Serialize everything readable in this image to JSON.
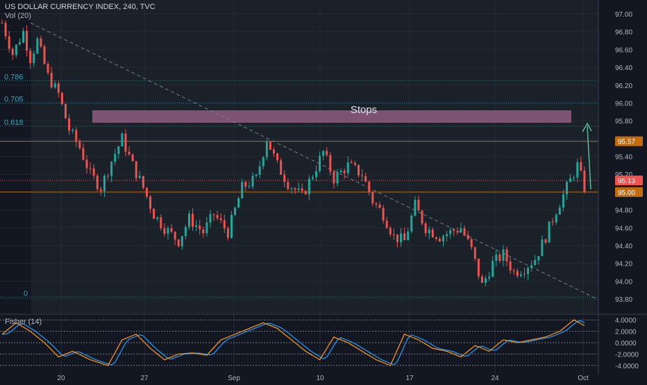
{
  "header": {
    "title": "US DOLLAR CURRENCY INDEX, 240, TVC",
    "volume_label": "Vol (20)"
  },
  "fisher": {
    "label": "Fisher (14)",
    "ticks": [
      "4.0000",
      "2.0000",
      "0.0000",
      "-2.0000",
      "-4.0000"
    ]
  },
  "annotations": {
    "stops_label": "Stops",
    "fib_levels": [
      {
        "label": "0.786",
        "price": 96.25
      },
      {
        "label": "0.705",
        "price": 96.0
      },
      {
        "label": "0.618",
        "price": 95.74
      },
      {
        "label": "0",
        "price": 93.82
      }
    ]
  },
  "price_tags": [
    {
      "label": "95.57",
      "price": 95.57,
      "color": "#c46c0d"
    },
    {
      "label": "95.13",
      "price": 95.13,
      "color": "#ef5350"
    },
    {
      "label": "95.00",
      "price": 95.0,
      "color": "#c46c0d"
    }
  ],
  "colors": {
    "background": "#131722",
    "up": "#26a69a",
    "down": "#ef5350",
    "stops_box": "#8e5c80",
    "fisher_main": "#f7931a",
    "fisher_trigger": "#2196f3"
  },
  "chart_data": {
    "type": "candlestick",
    "x_ticks": [
      "20",
      "27",
      "Sep",
      "10",
      "17",
      "24",
      "Oct"
    ],
    "y_ticks": [
      "97.00",
      "96.80",
      "96.60",
      "96.40",
      "96.20",
      "96.00",
      "95.80",
      "95.60",
      "95.40",
      "95.20",
      "95.00",
      "94.80",
      "94.60",
      "94.40",
      "94.20",
      "94.00",
      "93.80"
    ],
    "ylim": [
      93.75,
      97.05
    ],
    "series": [
      {
        "name": "Price (approximate closes)",
        "points": [
          [
            0,
            96.9
          ],
          [
            3,
            96.55
          ],
          [
            6,
            96.8
          ],
          [
            8,
            96.5
          ],
          [
            10,
            96.7
          ],
          [
            13,
            96.3
          ],
          [
            16,
            96.1
          ],
          [
            19,
            95.7
          ],
          [
            22,
            95.5
          ],
          [
            25,
            95.2
          ],
          [
            28,
            95.05
          ],
          [
            31,
            95.35
          ],
          [
            34,
            95.6
          ],
          [
            37,
            95.3
          ],
          [
            40,
            95.05
          ],
          [
            43,
            94.75
          ],
          [
            46,
            94.6
          ],
          [
            50,
            94.45
          ],
          [
            53,
            94.7
          ],
          [
            57,
            94.55
          ],
          [
            60,
            94.75
          ],
          [
            64,
            94.55
          ],
          [
            68,
            95.05
          ],
          [
            72,
            95.15
          ],
          [
            75,
            95.6
          ],
          [
            78,
            95.3
          ],
          [
            81,
            95.1
          ],
          [
            85,
            94.95
          ],
          [
            88,
            95.2
          ],
          [
            91,
            95.45
          ],
          [
            94,
            95.15
          ],
          [
            98,
            95.3
          ],
          [
            102,
            95.2
          ],
          [
            105,
            94.9
          ],
          [
            108,
            94.75
          ],
          [
            111,
            94.5
          ],
          [
            114,
            94.45
          ],
          [
            117,
            94.85
          ],
          [
            120,
            94.6
          ],
          [
            124,
            94.5
          ],
          [
            127,
            94.55
          ],
          [
            130,
            94.6
          ],
          [
            133,
            94.35
          ],
          [
            136,
            93.95
          ],
          [
            139,
            94.2
          ],
          [
            142,
            94.3
          ],
          [
            145,
            94.1
          ],
          [
            148,
            94.15
          ],
          [
            151,
            94.25
          ],
          [
            154,
            94.5
          ],
          [
            157,
            94.8
          ],
          [
            160,
            95.05
          ],
          [
            163,
            95.3
          ],
          [
            165,
            95.05
          ]
        ]
      },
      {
        "name": "Fisher (14) (approximate)",
        "points": [
          [
            0,
            1.5
          ],
          [
            4,
            3.5
          ],
          [
            8,
            2
          ],
          [
            12,
            0
          ],
          [
            16,
            -2.5
          ],
          [
            20,
            -1.5
          ],
          [
            25,
            -3
          ],
          [
            30,
            -4
          ],
          [
            34,
            0.5
          ],
          [
            38,
            1.5
          ],
          [
            42,
            -1
          ],
          [
            46,
            -3
          ],
          [
            50,
            -2
          ],
          [
            54,
            -1.8
          ],
          [
            58,
            -2.2
          ],
          [
            62,
            0.5
          ],
          [
            66,
            1.5
          ],
          [
            70,
            2.5
          ],
          [
            74,
            3.5
          ],
          [
            78,
            2.5
          ],
          [
            82,
            0.5
          ],
          [
            86,
            -1.5
          ],
          [
            90,
            -3
          ],
          [
            94,
            1
          ],
          [
            98,
            0
          ],
          [
            102,
            -1.5
          ],
          [
            106,
            -3
          ],
          [
            110,
            -4
          ],
          [
            114,
            1.5
          ],
          [
            118,
            0.5
          ],
          [
            122,
            -1
          ],
          [
            126,
            -1.5
          ],
          [
            130,
            -2.5
          ],
          [
            134,
            -0.5
          ],
          [
            138,
            -1.5
          ],
          [
            142,
            0.5
          ],
          [
            146,
            0
          ],
          [
            150,
            0.5
          ],
          [
            154,
            1
          ],
          [
            158,
            2
          ],
          [
            162,
            4
          ],
          [
            165,
            3
          ]
        ]
      }
    ]
  }
}
